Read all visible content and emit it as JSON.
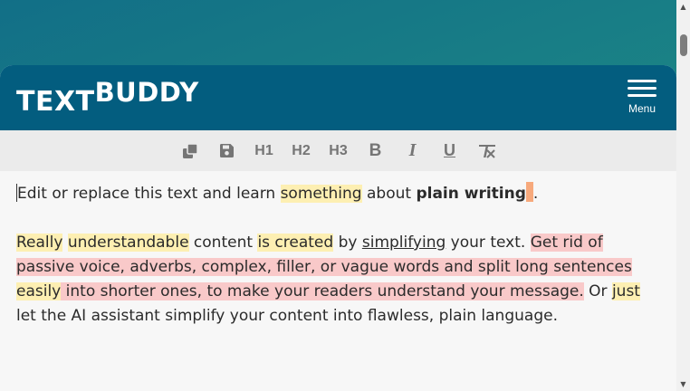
{
  "header": {
    "logo_part1": "TEXT",
    "logo_part2": "BUDDY",
    "menu_label": "Menu"
  },
  "toolbar": {
    "h1": "H1",
    "h2": "H2",
    "h3": "H3",
    "bold": "B",
    "italic": "I",
    "underline": "U",
    "icons": [
      "copy-icon",
      "save-icon",
      "clear-format-icon"
    ]
  },
  "editor": {
    "p1": {
      "t1": "Edit or replace this text and learn ",
      "t2": "something",
      "t3": " about ",
      "t4": "plain writing",
      "t5": "."
    },
    "p2": {
      "s1": "Really",
      "s2": " ",
      "s3": "understandable",
      "s4": " content ",
      "s5": "is created",
      "s6": " by ",
      "s7": "simplifying",
      "s8": " your text. ",
      "s9": "Get rid of passive voice, adverbs, complex, filler, or vague words and split long sentences ",
      "s10": "easily",
      "s11": " into shorter ones, to make your readers understand your message.",
      "s12": " Or ",
      "s13": "just",
      "s14": " let the AI assistant simplify your content into flawless, plain language."
    }
  },
  "colors": {
    "header": "#035d7f",
    "highlight_yellow": "#fdefb2",
    "highlight_red": "#f9c9c9",
    "highlight_orange": "#f7a97c"
  }
}
